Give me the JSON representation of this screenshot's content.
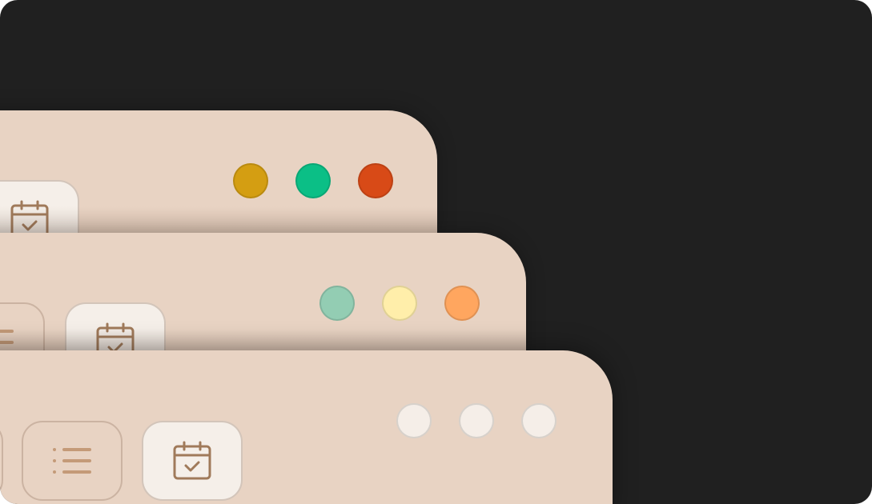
{
  "colors": {
    "backdrop": "#202020",
    "window_bg": "#e8d3c3",
    "icon_stroke": "#a07a5a",
    "button_active_bg": "#f5efe9"
  },
  "windows": [
    {
      "name": "window-back",
      "traffic_lights": [
        "#d49e12",
        "#0bbf86",
        "#d84a17"
      ],
      "segments": [
        {
          "icon": "calendar-check-icon",
          "active": true
        }
      ]
    },
    {
      "name": "window-middle",
      "traffic_lights": [
        "#93cdb3",
        "#ffeeaa",
        "#ffa65f"
      ],
      "segments": [
        {
          "icon": "list-icon",
          "active": false
        },
        {
          "icon": "calendar-check-icon",
          "active": true
        }
      ]
    },
    {
      "name": "window-front",
      "traffic_lights": [
        "#f5eee8",
        "#f5eee8",
        "#f5eee8"
      ],
      "segments": [
        {
          "icon": "list-icon",
          "active": false
        },
        {
          "icon": "calendar-check-icon",
          "active": true
        }
      ]
    }
  ]
}
